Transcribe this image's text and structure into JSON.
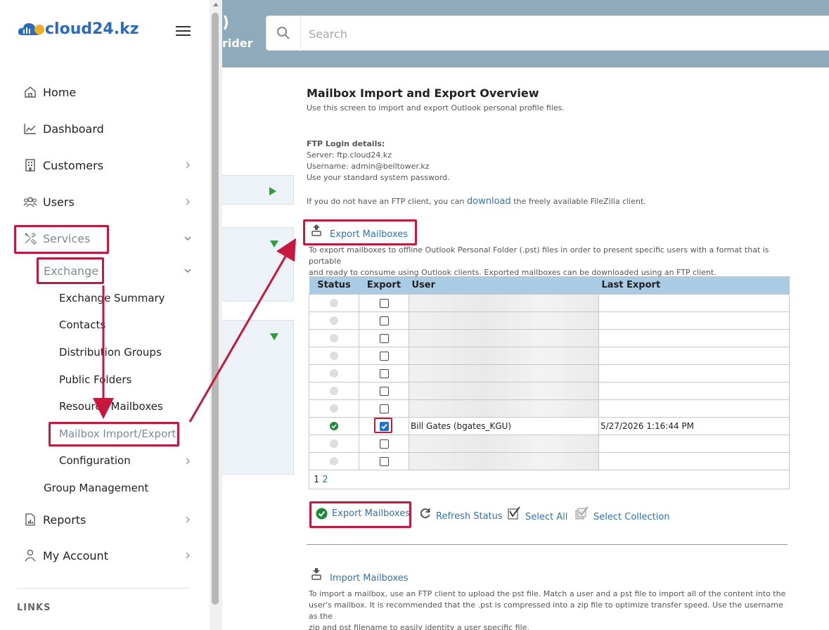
{
  "header": {
    "brand_frag_top": ")",
    "brand_frag_bottom": "rider",
    "search": {
      "placeholder": "Search"
    }
  },
  "sidebar": {
    "logo_text": "cloud24.kz",
    "items": [
      {
        "label": "Home",
        "icon": "home-icon"
      },
      {
        "label": "Dashboard",
        "icon": "chart-line-icon"
      },
      {
        "label": "Customers",
        "icon": "building-icon"
      },
      {
        "label": "Users",
        "icon": "users-icon"
      },
      {
        "label": "Services",
        "icon": "tools-icon"
      },
      {
        "label": "Reports",
        "icon": "report-icon"
      },
      {
        "label": "My Account",
        "icon": "user-icon"
      }
    ],
    "exchange_label": "Exchange",
    "exchange_sub": [
      "Exchange Summary",
      "Contacts",
      "Distribution Groups",
      "Public Folders",
      "Resource Mailboxes",
      "Mailbox Import/Export",
      "Configuration"
    ],
    "group_management": "Group Management",
    "links_title": "LINKS"
  },
  "main": {
    "title": "Mailbox Import and Export Overview",
    "subtitle": "Use this screen to import and export Outlook personal profile files.",
    "ftp": {
      "heading": "FTP Login details:",
      "server": "Server: ftp.cloud24.kz",
      "username": "Username: admin@belltower.kz",
      "password_note": "Use your standard system password."
    },
    "ftp_client_pre": "If you do not have an FTP client, you can",
    "ftp_client_link": "download",
    "ftp_client_post": "the freely available FileZilla client.",
    "export": {
      "heading": "Export Mailboxes",
      "desc_line1": "To export mailboxes to offline Outlook Personal Folder (.pst) files in order to present specific users with a format that is portable",
      "desc_line2": "and ready to consume using Outlook clients. Exported mailboxes can be downloaded using an FTP client.",
      "columns": [
        "Status",
        "Export",
        "User",
        "Last Export"
      ],
      "rows": [
        {
          "status": "none",
          "checked": false,
          "user": "",
          "last_export": ""
        },
        {
          "status": "none",
          "checked": false,
          "user": "",
          "last_export": ""
        },
        {
          "status": "none",
          "checked": false,
          "user": "",
          "last_export": ""
        },
        {
          "status": "none",
          "checked": false,
          "user": "",
          "last_export": ""
        },
        {
          "status": "none",
          "checked": false,
          "user": "",
          "last_export": ""
        },
        {
          "status": "none",
          "checked": false,
          "user": "",
          "last_export": ""
        },
        {
          "status": "none",
          "checked": false,
          "user": "",
          "last_export": ""
        },
        {
          "status": "ok",
          "checked": true,
          "user": "Bill Gates (bgates_KGU)",
          "last_export": "5/27/2026 1:16:44 PM"
        },
        {
          "status": "none",
          "checked": false,
          "user": "",
          "last_export": ""
        },
        {
          "status": "none",
          "checked": false,
          "user": "",
          "last_export": ""
        }
      ],
      "pages": [
        "1",
        "2"
      ],
      "actions": {
        "export": "Export Mailboxes",
        "refresh": "Refresh Status",
        "select_all": "Select All",
        "select_collection": "Select Collection"
      }
    },
    "import": {
      "heading": "Import Mailboxes",
      "desc_line1": "To import a mailbox, use an FTP client to upload the pst file. Match a user and a pst file to import all of the content into the",
      "desc_line2": "user's mailbox. It is recommended that the .pst is compressed into a zip file to optimize transfer speed. Use the username as the",
      "desc_line3": "zip and pst filename to easily identity a user specific file."
    }
  },
  "colors": {
    "accent": "#2e73b8",
    "highlight": "#c8163d",
    "header_bg": "#8faabb",
    "table_header": "#a9cbe3",
    "ok": "#1d8a3a"
  }
}
